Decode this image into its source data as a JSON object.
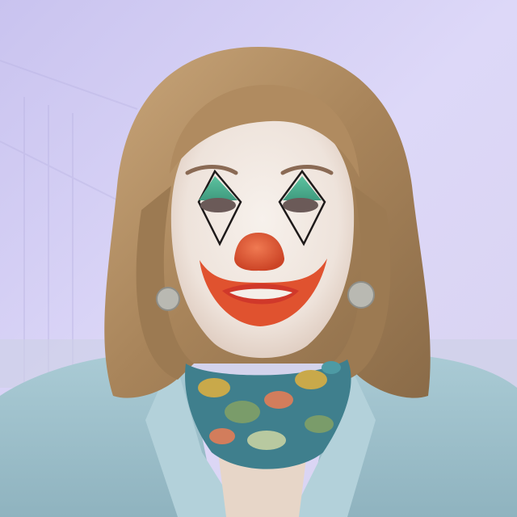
{
  "image": {
    "subject": "portrait",
    "background_color": "#d6d0f4",
    "face_paint": {
      "base_color": "#f2ece6",
      "eyeshadow_color": "#55b596",
      "nose_color": "#e0522f",
      "mouth_color": "#e0522f",
      "outline_color": "#1e1a1a"
    },
    "hair_color": "#b89468",
    "jacket_color": "#9fc1cd",
    "scarf_colors": [
      "#3f7f8d",
      "#c9a94a",
      "#7a9c6a",
      "#d27d5c"
    ],
    "earring_color": "#b9b9b2"
  }
}
